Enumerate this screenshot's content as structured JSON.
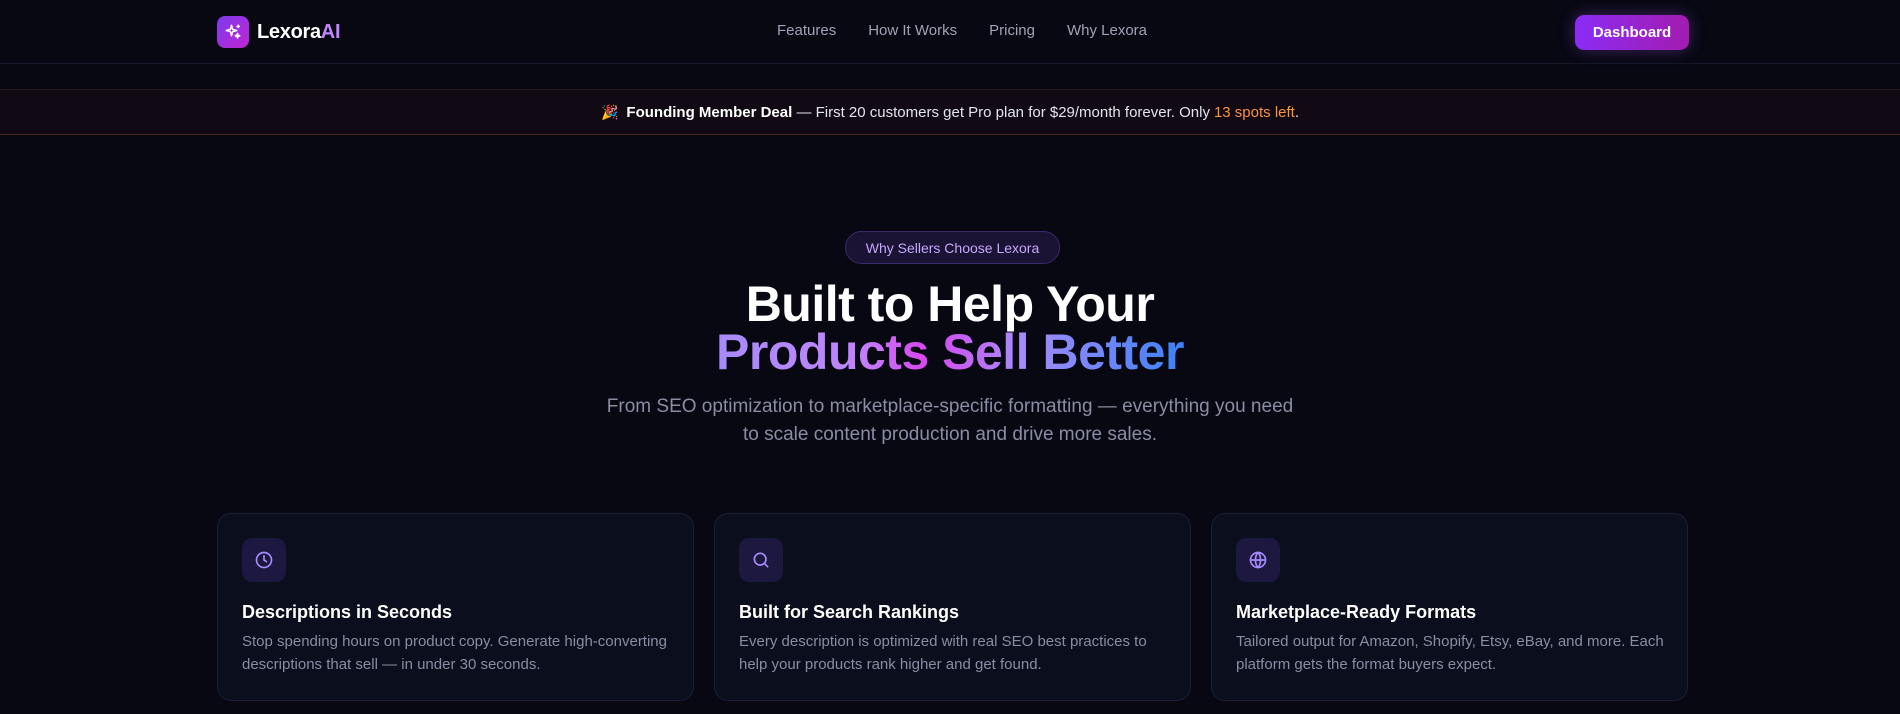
{
  "nav": {
    "logo_main": "Lexora",
    "logo_ai": "AI",
    "logo_icon": "sparkles-icon",
    "links": [
      "Features",
      "How It Works",
      "Pricing",
      "Why Lexora"
    ],
    "dashboard_label": "Dashboard"
  },
  "promo": {
    "emoji": "🎉",
    "deal_label": "Founding Member Deal",
    "text": "— First 20 customers get Pro plan for $29/month forever. Only",
    "spots": "13 spots left",
    "period": "."
  },
  "hero": {
    "pill": "Why Sellers Choose Lexora",
    "title_line1": "Built to Help Your",
    "title_line2": "Products Sell Better",
    "subtitle": "From SEO optimization to marketplace-specific formatting — everything you need to scale content production and drive more sales."
  },
  "features": [
    {
      "icon": "clock-icon",
      "title": "Descriptions in Seconds",
      "description": "Stop spending hours on product copy. Generate high-converting descriptions that sell — in under 30 seconds."
    },
    {
      "icon": "search-icon",
      "title": "Built for Search Rankings",
      "description": "Every description is optimized with real SEO best practices to help your products rank higher and get found."
    },
    {
      "icon": "globe-icon",
      "title": "Marketplace-Ready Formats",
      "description": "Tailored output for Amazon, Shopify, Etsy, eBay, and more. Each platform gets the format buyers expect."
    }
  ],
  "colors": {
    "background": "#070812",
    "accent": "#8b2cf5",
    "highlight_orange": "#fb923c"
  }
}
